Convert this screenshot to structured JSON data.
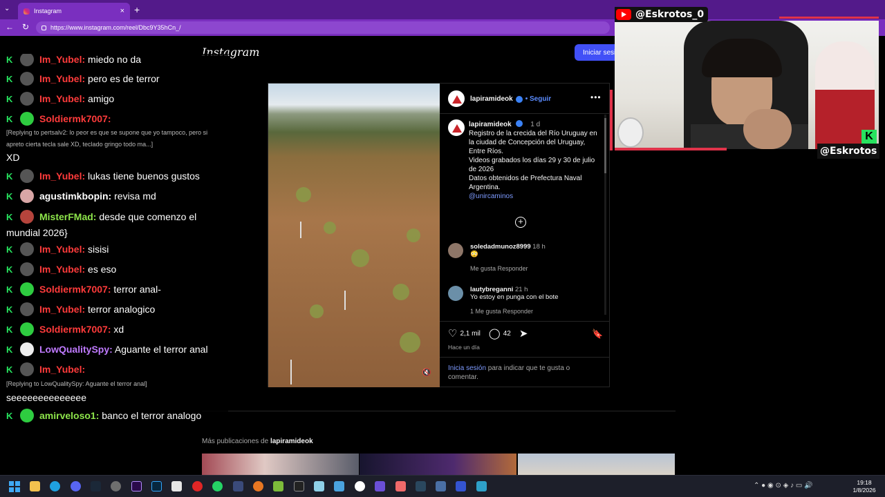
{
  "browser": {
    "tab_title": "Instagram",
    "new_tab": "+",
    "close_tab": "×",
    "url": "https://www.instagram.com/reel/Dbc9Y35hCn_/"
  },
  "instagram": {
    "logo": "Instagram",
    "login_button": "Iniciar sesión",
    "author": "lapiramideok",
    "follow": "• Seguir",
    "caption_time": "1 d",
    "caption_lines": [
      "Registro de la crecida del Río Uruguay en la ciudad de Concepción del Uruguay, Entre Ríos.",
      "Videos grabados los días 29 y 30 de julio de 2026",
      "Datos obtenidos de Prefectura Naval Argentina."
    ],
    "caption_mention": "@unircaminos",
    "comments": [
      {
        "user": "soledadmunoz8999",
        "time": "18 h",
        "text": "😳",
        "actions": "Me gusta     Responder"
      },
      {
        "user": "lautybreganni",
        "time": "21 h",
        "text": "Yo estoy en punga con el bote",
        "actions": "1 Me gusta     Responder"
      }
    ],
    "likes": "2,1 mil",
    "comment_count": "42",
    "posted": "Hace un día",
    "login_link": "Inicia sesión",
    "login_rest": " para indicar que te gusta o comentar.",
    "more_posts_prefix": "Más publicaciones de ",
    "more_posts_user": "lapiramideok"
  },
  "chat": {
    "messages": [
      {
        "user": "Im_Yubel:",
        "text": " miedo no da",
        "color": "#ff3b3b"
      },
      {
        "user": "Im_Yubel:",
        "text": " pero es de terror",
        "color": "#ff3b3b"
      },
      {
        "user": "Im_Yubel:",
        "text": " amigo",
        "color": "#ff3b3b"
      },
      {
        "user": "Soldiermk7007:",
        "text": "",
        "color": "#ff3b3b"
      },
      {
        "user": "Im_Yubel:",
        "text": " lukas tiene buenos gustos",
        "color": "#ff3b3b"
      },
      {
        "user": "agustimkbopin:",
        "text": " revisa md",
        "color": "#ffffff"
      },
      {
        "user": "MisterFMad:",
        "text": " desde que comenzo el mundial 2026}",
        "color": "#8ee64b"
      },
      {
        "user": "Im_Yubel:",
        "text": " sisisi",
        "color": "#ff3b3b"
      },
      {
        "user": "Im_Yubel:",
        "text": " es eso",
        "color": "#ff3b3b"
      },
      {
        "user": "Soldiermk7007:",
        "text": " terror anal-",
        "color": "#ff3b3b"
      },
      {
        "user": "Im_Yubel:",
        "text": " terror analogico",
        "color": "#ff3b3b"
      },
      {
        "user": "Soldiermk7007:",
        "text": " xd",
        "color": "#ff3b3b"
      },
      {
        "user": "LowQualitySpy:",
        "text": " Aguante el terror anal",
        "color": "#c07bff"
      },
      {
        "user": "Im_Yubel:",
        "text": "",
        "color": "#ff3b3b"
      },
      {
        "user": "amirveloso1:",
        "text": " banco el terror analogo",
        "color": "#8ee64b"
      }
    ],
    "reply1": "[Replying to pertsalv2: lo peor es que se supone que yo tampoco, pero si apreto cierta tecla sale XD, teclado gringo todo ma...]",
    "reply1_text": "XD",
    "reply2": "[Replying to LowQualitySpy: Aguante el terror anal]",
    "reply2_text": "seeeeeeeeeeeeee"
  },
  "overlay": {
    "youtube_handle": "@Eskrotos_0",
    "kick_handle": "@Eskrotos",
    "kick_logo": "K"
  },
  "taskbar": {
    "time": "19:18",
    "date": "1/8/2026"
  },
  "colors": {
    "browser_tab": "#7a2fbf",
    "instagram_blue": "#4150f7",
    "kick_green": "#27e35f",
    "youtube_red": "#ff0000"
  }
}
